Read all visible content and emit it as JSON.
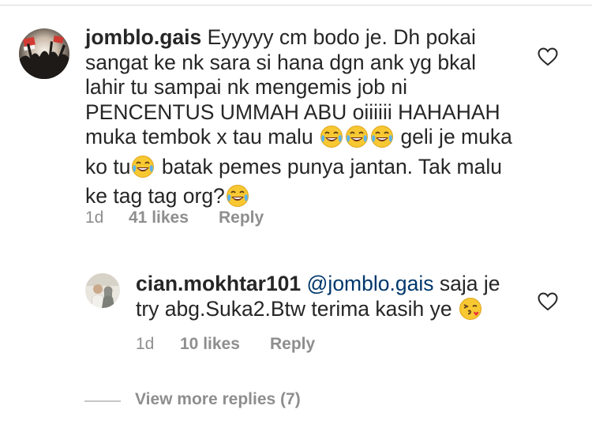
{
  "comment": {
    "username": "jomblo.gais",
    "text_1": "Eyyyyy cm bodo je. Dh pokai sangat ke nk sara si hana dgn ank yg bkal lahir tu sampai nk mengemis job ni PENCENTUS UMMAH ABU oiiiiii HAHAHAH muka tembok x tau malu",
    "text_2": "geli je muka ko tu",
    "text_3": "batak pemes punya jantan. Tak malu ke tag tag org?",
    "time": "1d",
    "likes": "41 likes",
    "reply": "Reply",
    "emoji_icon": "face-with-tears-of-joy-icon"
  },
  "reply_comment": {
    "username": "cian.mokhtar101",
    "mention": "@jomblo.gais",
    "text": "saja je try abg.Suka2.Btw terima kasih ye",
    "time": "1d",
    "likes": "10 likes",
    "reply": "Reply",
    "emoji_icon": "face-blowing-kiss-icon"
  },
  "view_more": "View more replies (7)",
  "colors": {
    "text": "#262626",
    "meta": "#8e8e8e",
    "mention": "#00376b",
    "divider": "#dbdbdb"
  }
}
